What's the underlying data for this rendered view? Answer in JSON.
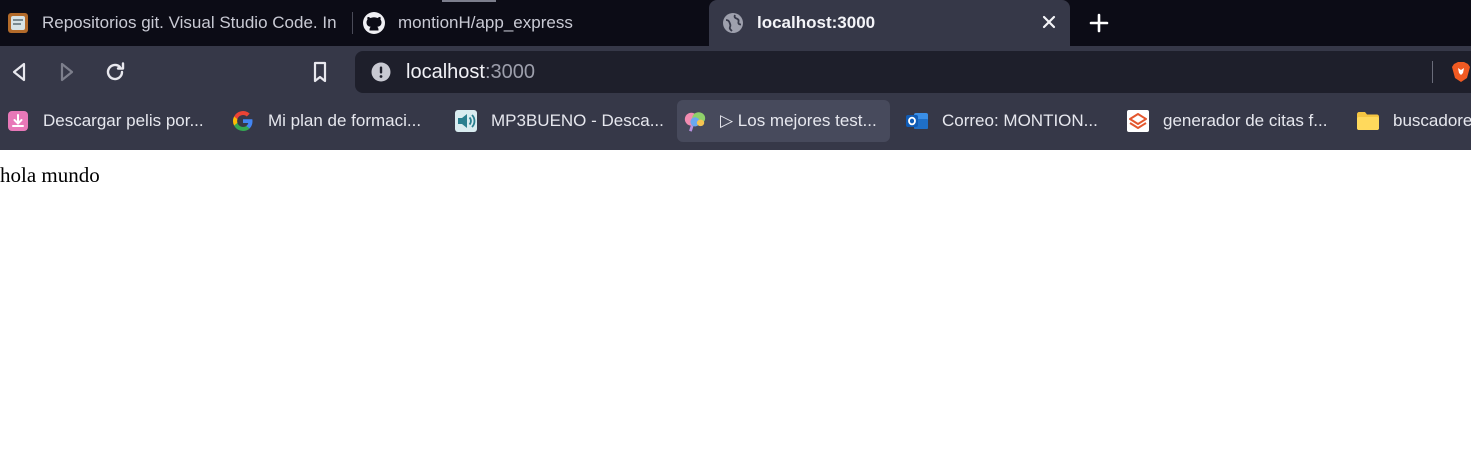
{
  "tabs": [
    {
      "title": "Repositorios git. Visual Studio Code. In",
      "icon": "vscode-course-icon",
      "active": false
    },
    {
      "title": "montionH/app_express",
      "icon": "github-icon",
      "active": false
    },
    {
      "title": "localhost:3000",
      "icon": "globe-icon",
      "active": true
    }
  ],
  "toolbar": {
    "url_host": "localhost",
    "url_port": ":3000"
  },
  "bookmarks": [
    {
      "label": "Descargar pelis por...",
      "icon": "download-icon"
    },
    {
      "label": "Mi plan de formaci...",
      "icon": "google-icon"
    },
    {
      "label": "MP3BUENO - Desca...",
      "icon": "speaker-icon"
    },
    {
      "label": "▷ Los mejores test...",
      "icon": "brain-icon"
    },
    {
      "label": "Correo: MONTION...",
      "icon": "outlook-icon"
    },
    {
      "label": "generador de citas f...",
      "icon": "scribbr-icon"
    },
    {
      "label": "buscadores",
      "icon": "folder-icon"
    }
  ],
  "page": {
    "body_text": "hola mundo"
  },
  "colors": {
    "tabstrip_bg": "#0c0c16",
    "toolbar_bg": "#363848",
    "urlbar_bg": "#1e1f2b",
    "brave_orange": "#f15a22"
  }
}
